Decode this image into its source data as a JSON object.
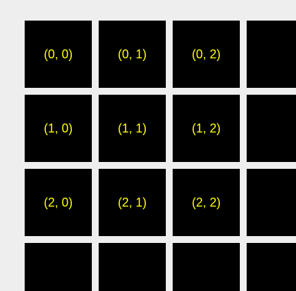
{
  "colors": {
    "background": "#eeeeee",
    "cell": "#000000",
    "label": "#ffff00"
  },
  "grid": {
    "rows": [
      {
        "cells": [
          {
            "label": "(0, 0)"
          },
          {
            "label": "(0, 1)"
          },
          {
            "label": "(0, 2)"
          },
          {
            "label": ""
          }
        ]
      },
      {
        "cells": [
          {
            "label": "(1, 0)"
          },
          {
            "label": "(1, 1)"
          },
          {
            "label": "(1, 2)"
          },
          {
            "label": ""
          }
        ]
      },
      {
        "cells": [
          {
            "label": "(2, 0)"
          },
          {
            "label": "(2, 1)"
          },
          {
            "label": "(2, 2)"
          },
          {
            "label": ""
          }
        ]
      },
      {
        "cells": [
          {
            "label": ""
          },
          {
            "label": ""
          },
          {
            "label": ""
          },
          {
            "label": ""
          }
        ]
      }
    ]
  }
}
